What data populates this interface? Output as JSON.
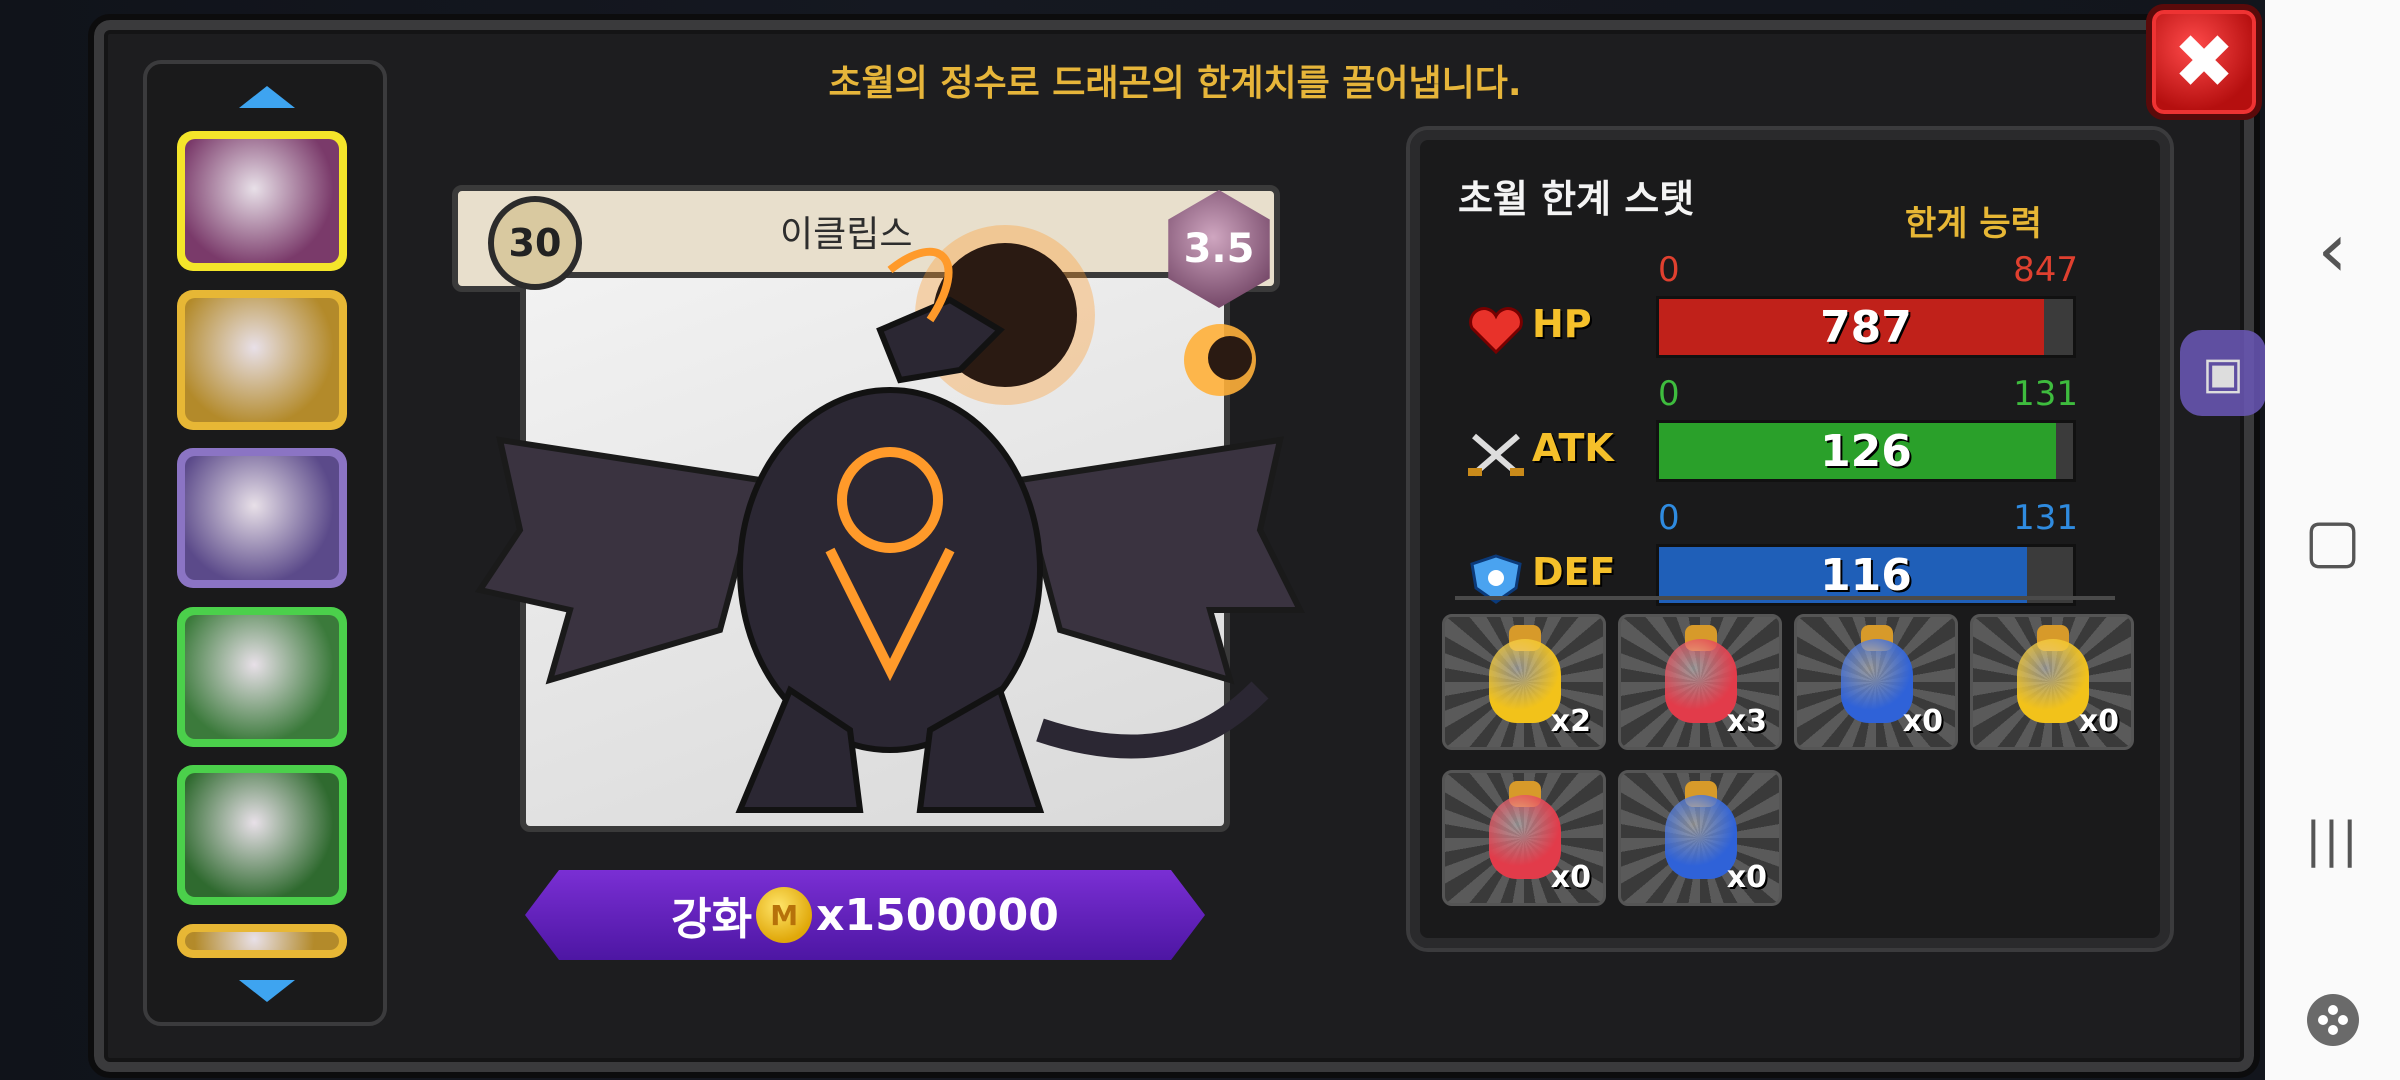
{
  "header": {
    "title": "초월의 정수로 드래곤의 한계치를 끌어냅니다."
  },
  "close": {
    "icon": "close-icon",
    "glyph": "✖"
  },
  "dragon_list": {
    "up_icon": "arrow-up-icon",
    "down_icon": "arrow-down-icon",
    "items": [
      {
        "name": "black-dragon",
        "border": "#f4e52a",
        "bg": "#7a3a6a"
      },
      {
        "name": "gold-dragon",
        "border": "#e7b735",
        "bg": "#b38a2a"
      },
      {
        "name": "silver-dragon",
        "border": "#8b74c4",
        "bg": "#5b4a8a"
      },
      {
        "name": "pink-dragon",
        "border": "#4bd04b",
        "bg": "#3b7a3b"
      },
      {
        "name": "green-dragon",
        "border": "#4bd04b",
        "bg": "#2f6a2f"
      },
      {
        "name": "partial-dragon",
        "border": "#e7b735",
        "bg": "#b38a2a"
      }
    ]
  },
  "card": {
    "level": "30",
    "name": "이클립스",
    "grade": "3.5"
  },
  "enhance": {
    "label": "강화",
    "coin_glyph": "M",
    "cost": "x1500000"
  },
  "stats": {
    "title": "초월 한계 스탯",
    "limit_label": "한계 능력",
    "items": [
      {
        "name": "HP",
        "icon": "heart-icon",
        "min": "0",
        "max": "847",
        "value": "787",
        "fraction": 0.93,
        "color": "#c0211a",
        "minColor": "#e0402f",
        "maxColor": "#e0402f"
      },
      {
        "name": "ATK",
        "icon": "crossed-swords-icon",
        "min": "0",
        "max": "131",
        "value": "126",
        "fraction": 0.96,
        "color": "#2aa02a",
        "minColor": "#3ebc3e",
        "maxColor": "#3ebc3e"
      },
      {
        "name": "DEF",
        "icon": "shield-icon",
        "min": "0",
        "max": "131",
        "value": "116",
        "fraction": 0.89,
        "color": "#1f5fb8",
        "minColor": "#2f8be0",
        "maxColor": "#2f8be0"
      }
    ]
  },
  "potions": [
    {
      "name": "gold-potion",
      "color": "#f2c21a",
      "count": "x2"
    },
    {
      "name": "red-potion",
      "color": "#e23b4a",
      "count": "x3"
    },
    {
      "name": "blue-potion",
      "color": "#2f62d8",
      "count": "x0"
    },
    {
      "name": "large-gold-potion",
      "color": "#f2c21a",
      "count": "x0"
    },
    {
      "name": "large-red-potion",
      "color": "#e23b4a",
      "count": "x0"
    },
    {
      "name": "large-blue-potion",
      "color": "#2f62d8",
      "count": "x0"
    }
  ],
  "android_nav": {
    "back": "‹",
    "home": "▢",
    "recents": "|||",
    "gamepad_icon": "gamepad-icon"
  }
}
